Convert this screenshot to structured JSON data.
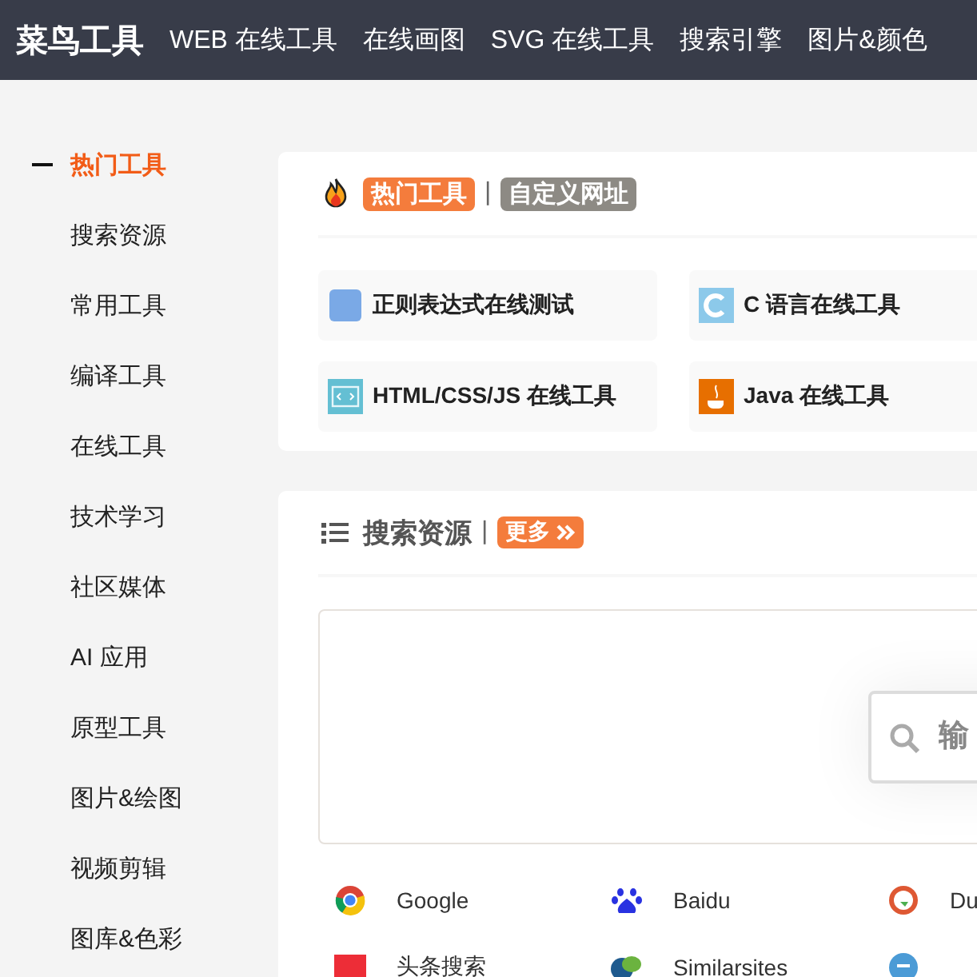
{
  "header": {
    "logo": "菜鸟工具",
    "nav": [
      "WEB 在线工具",
      "在线画图",
      "SVG 在线工具",
      "搜索引擎",
      "图片&颜色"
    ]
  },
  "sidebar": {
    "items": [
      {
        "label": "热门工具",
        "selected": true
      },
      {
        "label": "搜索资源",
        "selected": false
      },
      {
        "label": "常用工具",
        "selected": false
      },
      {
        "label": "编译工具",
        "selected": false
      },
      {
        "label": "在线工具",
        "selected": false
      },
      {
        "label": "技术学习",
        "selected": false
      },
      {
        "label": "社区媒体",
        "selected": false
      },
      {
        "label": "AI 应用",
        "selected": false
      },
      {
        "label": "原型工具",
        "selected": false
      },
      {
        "label": "图片&绘图",
        "selected": false
      },
      {
        "label": "视频剪辑",
        "selected": false
      },
      {
        "label": "图库&色彩",
        "selected": false
      }
    ]
  },
  "hot_tools": {
    "tabs": [
      {
        "label": "热门工具",
        "selected": true
      },
      {
        "label": "自定义网址",
        "selected": false
      }
    ],
    "separator": "|",
    "items": [
      {
        "label": "正则表达式在线测试",
        "kind": "regex"
      },
      {
        "label": "C 语言在线工具",
        "kind": "c"
      },
      {
        "label": "HTML/CSS/JS 在线工具",
        "kind": "html"
      },
      {
        "label": "Java 在线工具",
        "kind": "java"
      }
    ]
  },
  "search_resources": {
    "title": "搜索资源",
    "separator": "|",
    "more": "更多",
    "search": {
      "placeholder": "输"
    },
    "links": [
      {
        "label": "Google",
        "kind": "google"
      },
      {
        "label": "Baidu",
        "kind": "baidu"
      },
      {
        "label": "Du",
        "kind": "duckduckgo"
      },
      {
        "label": "头条搜索",
        "kind": "toutiao"
      },
      {
        "label": "Similarsites",
        "kind": "similarsites"
      },
      {
        "kind": "cc"
      }
    ]
  }
}
